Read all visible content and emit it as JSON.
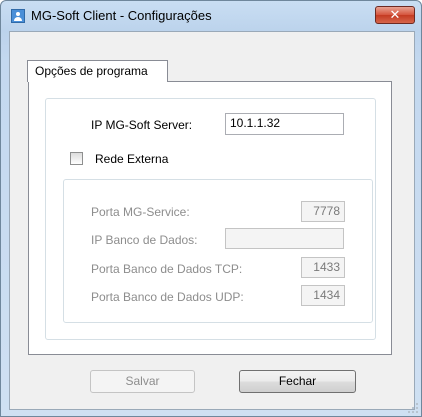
{
  "window": {
    "title": "MG-Soft Client - Configurações",
    "close_glyph": "✕",
    "icon": "user-icon",
    "close_color": "#c9432b"
  },
  "tabs": [
    {
      "label": "Opções de programa",
      "selected": true
    }
  ],
  "form": {
    "server_ip_label": "IP MG-Soft Server:",
    "server_ip_value": "10.1.1.32",
    "external_network_label": "Rede Externa",
    "external_network_checked": false,
    "external": {
      "service_port_label": "Porta MG-Service:",
      "service_port_value": "7778",
      "db_ip_label": "IP Banco de Dados:",
      "db_ip_value": "",
      "db_tcp_port_label": "Porta Banco de Dados TCP:",
      "db_tcp_port_value": "1433",
      "db_udp_port_label": "Porta Banco de Dados UDP:",
      "db_udp_port_value": "1434"
    }
  },
  "buttons": {
    "save_label": "Salvar",
    "close_label": "Fechar"
  }
}
